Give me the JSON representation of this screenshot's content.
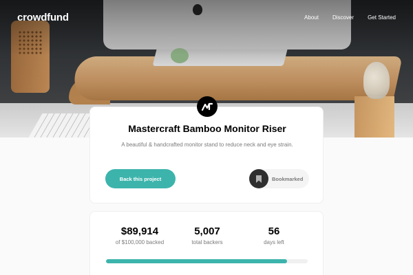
{
  "nav": {
    "logo": "crowdfund",
    "links": [
      "About",
      "Discover",
      "Get Started"
    ]
  },
  "project": {
    "title": "Mastercraft Bamboo Monitor Riser",
    "description": "A beautiful & handcrafted monitor stand to reduce neck and eye strain.",
    "back_label": "Back this project",
    "bookmark_label": "Bookmarked"
  },
  "stats": {
    "backed": {
      "value": "$89,914",
      "label": "of $100,000 backed"
    },
    "backers": {
      "value": "5,007",
      "label": "total backers"
    },
    "days": {
      "value": "56",
      "label": "days left"
    },
    "progress_fraction": 0.89914
  },
  "colors": {
    "accent": "#3cb4ac",
    "dark": "#2f2f2f",
    "muted": "#7a7a7a"
  },
  "icons": {
    "brand": "mastercraft-logo-icon",
    "bookmark": "bookmark-icon"
  }
}
